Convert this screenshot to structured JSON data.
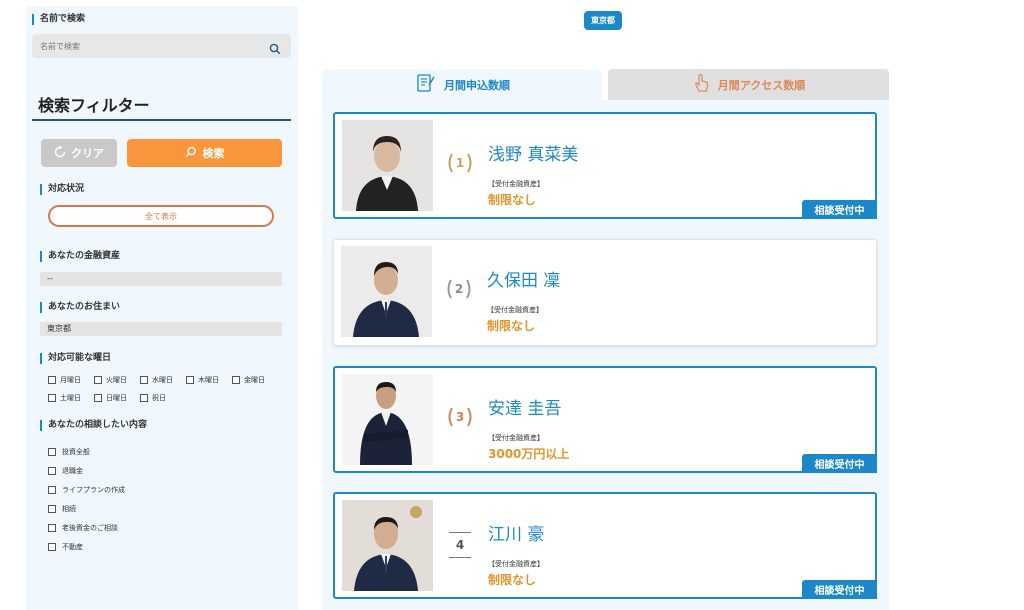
{
  "sidebar": {
    "name_search_label": "名前で検索",
    "name_search_placeholder": "名前で検索",
    "filter_title": "検索フィルター",
    "clear_label": "クリア",
    "search_label": "検索",
    "status_heading": "対応状況",
    "status_value": "全て表示",
    "assets_heading": "あなたの金融資産",
    "assets_value": "--",
    "residence_heading": "あなたのお住まい",
    "residence_value": "東京都",
    "days_heading": "対応可能な曜日",
    "days": [
      "月曜日",
      "火曜日",
      "水曜日",
      "木曜日",
      "金曜日",
      "土曜日",
      "日曜日",
      "祝日"
    ],
    "topics_heading": "あなたの相談したい内容",
    "topics": [
      "投資全般",
      "退職金",
      "ライフプランの作成",
      "相続",
      "老後資金のご相談",
      "不動産"
    ]
  },
  "main": {
    "prefecture_badge": "東京都",
    "tabs": [
      {
        "label": "月間申込数順",
        "icon": "document-chart-icon",
        "active": true
      },
      {
        "label": "月間アクセス数順",
        "icon": "pointer-hand-icon",
        "active": false
      }
    ],
    "advisors": [
      {
        "rank": "1",
        "name": "浅野 真菜美",
        "asset_label": "【受付金融資産】",
        "asset_value": "制限なし",
        "status": "相談受付中",
        "rank_color": "#c9a15a"
      },
      {
        "rank": "2",
        "name": "久保田 凜",
        "asset_label": "【受付金融資産】",
        "asset_value": "制限なし",
        "status": "",
        "rank_color": "#9a9a9a"
      },
      {
        "rank": "3",
        "name": "安達 圭吾",
        "asset_label": "【受付金融資産】",
        "asset_value": "3000万円以上",
        "status": "相談受付中",
        "rank_color": "#c98757"
      },
      {
        "rank": "4",
        "name": "江川 豪",
        "asset_label": "【受付金融資産】",
        "asset_value": "制限なし",
        "status": "相談受付中",
        "rank_color": "#555555"
      }
    ]
  },
  "colors": {
    "primary": "#1d88c9",
    "accent_orange": "#f8953d",
    "asset_gold": "#e2962a",
    "panel_bg": "#f1f8fd"
  }
}
